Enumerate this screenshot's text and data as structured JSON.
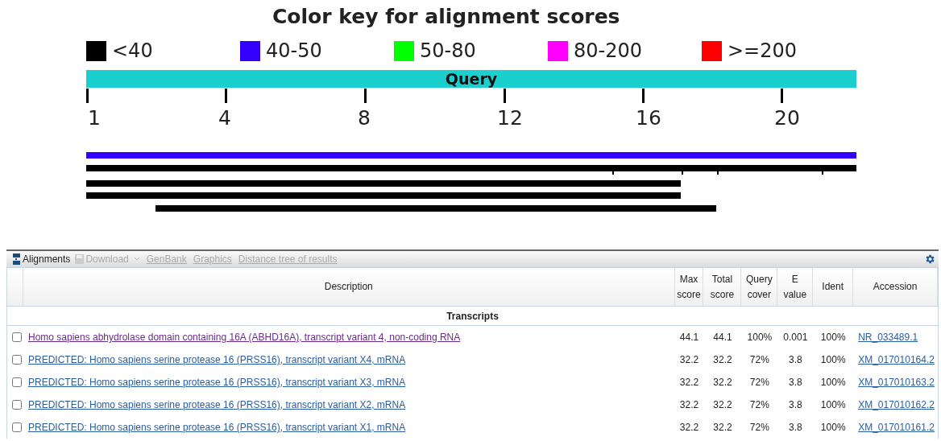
{
  "color_key": {
    "title": "Color key for alignment scores",
    "legend": [
      {
        "label": "<40",
        "color": "#000000"
      },
      {
        "label": "40-50",
        "color": "#3300ff"
      },
      {
        "label": "50-80",
        "color": "#00ff00"
      },
      {
        "label": "80-200",
        "color": "#ff00ff"
      },
      {
        "label": ">=200",
        "color": "#ff0000"
      }
    ],
    "query_label": "Query",
    "ruler_ticks": [
      "1",
      "4",
      "8",
      "12",
      "16",
      "20"
    ],
    "hits": [
      {
        "color": "#3300ff"
      },
      {
        "color": "#000000"
      },
      {
        "color": "#000000"
      },
      {
        "color": "#000000"
      },
      {
        "color": "#000000"
      }
    ]
  },
  "toolbar": {
    "items": [
      {
        "label": "Alignments",
        "disabled": false
      },
      {
        "label": "Download",
        "disabled": true
      },
      {
        "label": "GenBank",
        "disabled": true
      },
      {
        "label": "Graphics",
        "disabled": true
      },
      {
        "label": "Distance tree of results",
        "disabled": true
      }
    ]
  },
  "table": {
    "columns": [
      "Description",
      "Max score",
      "Total score",
      "Query cover",
      "E value",
      "Ident",
      "Accession"
    ],
    "section": "Transcripts",
    "rows": [
      {
        "checked": false,
        "visited": true,
        "description": "Homo sapiens abhydrolase domain containing 16A (ABHD16A), transcript variant 4, non-coding RNA",
        "max_score": "44.1",
        "total_score": "44.1",
        "query_cover": "100%",
        "e_value": "0.001",
        "ident": "100%",
        "accession": "NR_033489.1"
      },
      {
        "checked": false,
        "visited": false,
        "description": "PREDICTED: Homo sapiens serine protease 16 (PRSS16), transcript variant X4, mRNA",
        "max_score": "32.2",
        "total_score": "32.2",
        "query_cover": "72%",
        "e_value": "3.8",
        "ident": "100%",
        "accession": "XM_017010164.2"
      },
      {
        "checked": false,
        "visited": false,
        "description": "PREDICTED: Homo sapiens serine protease 16 (PRSS16), transcript variant X3, mRNA",
        "max_score": "32.2",
        "total_score": "32.2",
        "query_cover": "72%",
        "e_value": "3.8",
        "ident": "100%",
        "accession": "XM_017010163.2"
      },
      {
        "checked": false,
        "visited": false,
        "description": "PREDICTED: Homo sapiens serine protease 16 (PRSS16), transcript variant X2, mRNA",
        "max_score": "32.2",
        "total_score": "32.2",
        "query_cover": "72%",
        "e_value": "3.8",
        "ident": "100%",
        "accession": "XM_017010162.2"
      },
      {
        "checked": false,
        "visited": false,
        "description": "PREDICTED: Homo sapiens serine protease 16 (PRSS16), transcript variant X1, mRNA",
        "max_score": "32.2",
        "total_score": "32.2",
        "query_cover": "72%",
        "e_value": "3.8",
        "ident": "100%",
        "accession": "XM_017010161.2"
      }
    ]
  }
}
